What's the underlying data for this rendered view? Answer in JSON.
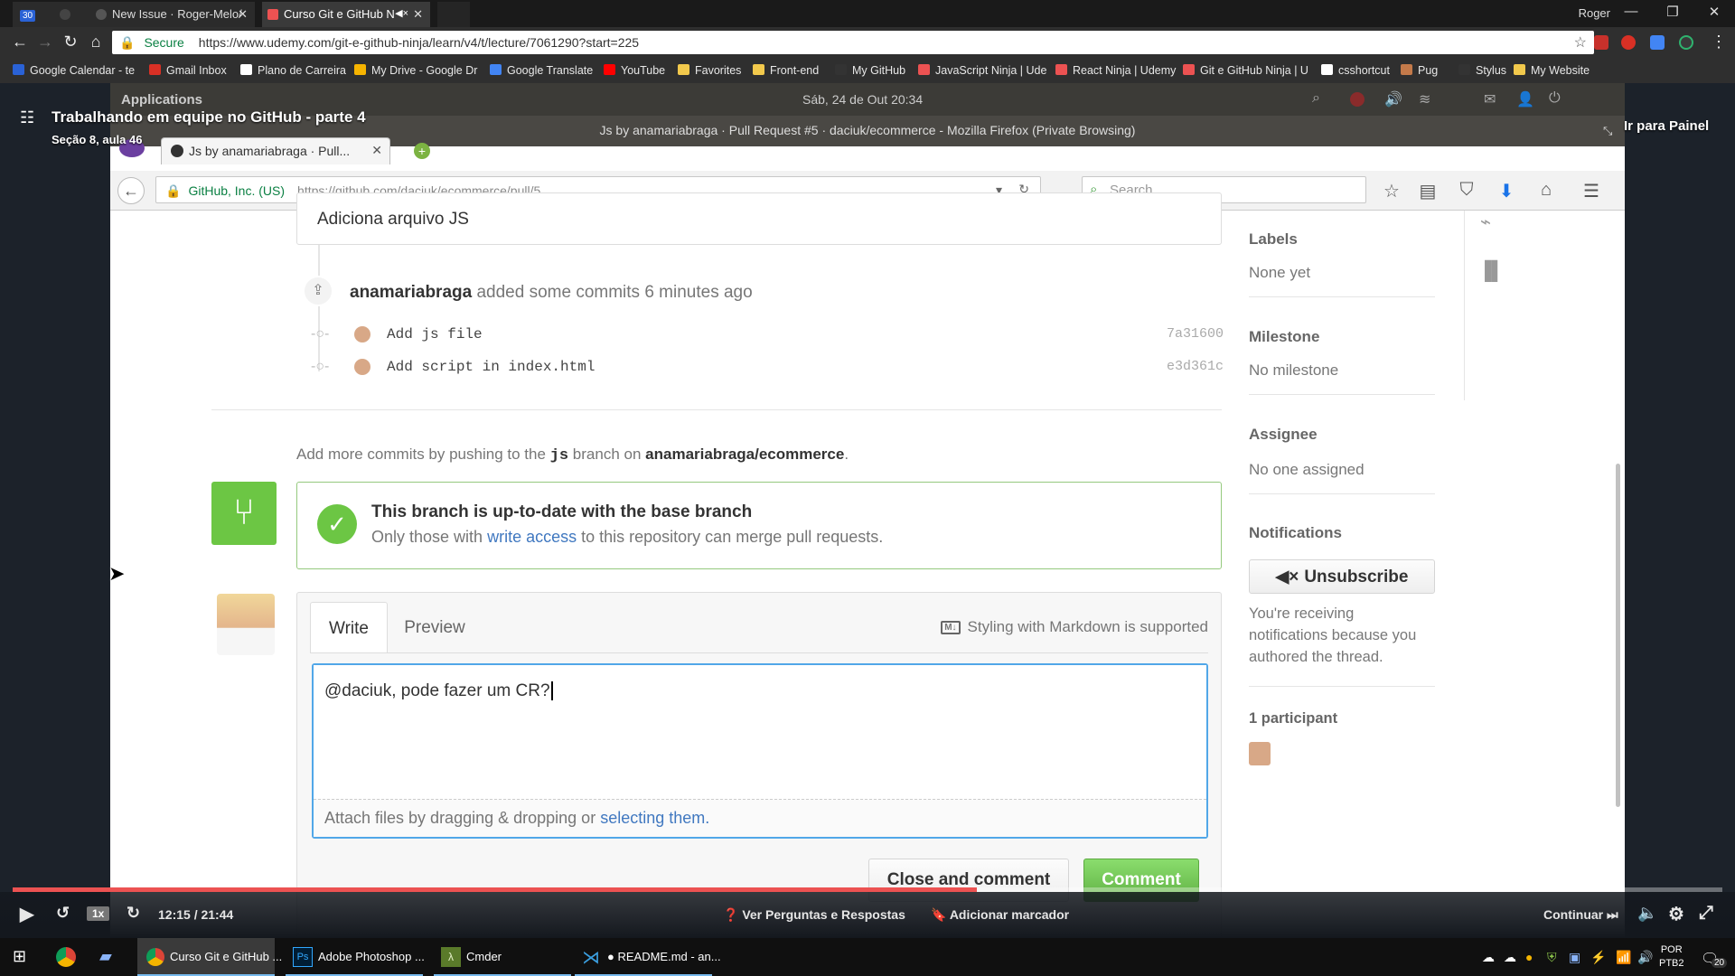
{
  "chrome": {
    "tabs": [
      {
        "label": "30"
      },
      {
        "label": ""
      },
      {
        "label": "New Issue · Roger-Melo/"
      },
      {
        "label": "Curso Git e GitHub N"
      }
    ],
    "user": "Roger",
    "secure_label": "Secure",
    "url": "https://www.udemy.com/git-e-github-ninja/learn/v4/t/lecture/7061290?start=225"
  },
  "bookmarks": [
    {
      "label": "Google Calendar - te",
      "color": "#2a62d6"
    },
    {
      "label": "Gmail Inbox",
      "color": "#d93025"
    },
    {
      "label": "Plano de Carreira",
      "color": "#ffffff"
    },
    {
      "label": "My Drive - Google Dr",
      "color": "#f6b400"
    },
    {
      "label": "Google Translate",
      "color": "#4285f4"
    },
    {
      "label": "YouTube",
      "color": "#ff0000"
    },
    {
      "label": "Favorites",
      "color": "#f2c94c"
    },
    {
      "label": "Front-end",
      "color": "#f2c94c"
    },
    {
      "label": "My GitHub",
      "color": "#333333"
    },
    {
      "label": "JavaScript Ninja | Ude",
      "color": "#ec5252"
    },
    {
      "label": "React Ninja | Udemy",
      "color": "#ec5252"
    },
    {
      "label": "Git e GitHub Ninja | U",
      "color": "#ec5252"
    },
    {
      "label": "csshortcut",
      "color": "#ffffff"
    },
    {
      "label": "Pug",
      "color": "#c47a4a"
    },
    {
      "label": "Stylus",
      "color": "#333333"
    },
    {
      "label": "My Website",
      "color": "#f2c94c"
    }
  ],
  "course": {
    "title": "Trabalhando em equipe no GitHub - parte 4",
    "subtitle": "Seção 8, aula 46",
    "goto_panel": "Ir para Painel"
  },
  "ubuntu": {
    "app_menu": "Applications",
    "clock": "Sáb, 24 de Out 20:34"
  },
  "firefox": {
    "window_title": "Js by anamariabraga · Pull Request #5 · daciuk/ecommerce - Mozilla Firefox (Private Browsing)",
    "tab_label": "Js by anamariabraga · Pull...",
    "identity": "GitHub, Inc. (US)",
    "url": "https://github.com/daciuk/ecommerce/pull/5",
    "search_placeholder": "Search"
  },
  "pr": {
    "first_comment_text": "Adiciona arquivo JS",
    "commits_author": "anamariabraga",
    "commits_event": "added some commits 6 minutes ago",
    "commits": [
      {
        "message": "Add js file",
        "sha": "7a31600"
      },
      {
        "message": "Add script in index.html",
        "sha": "e3d361c"
      }
    ],
    "push_hint_prefix": "Add more commits by pushing to the",
    "push_branch": "js",
    "push_hint_mid": "branch on",
    "push_repo": "anamariabraga/ecommerce",
    "merge_title": "This branch is up-to-date with the base branch",
    "merge_desc_prefix": "Only those with",
    "merge_desc_link": "write access",
    "merge_desc_suffix": "to this repository can merge pull requests.",
    "tab_write": "Write",
    "tab_preview": "Preview",
    "markdown_hint": "Styling with Markdown is supported",
    "comment_value": "@daciuk, pode fazer um CR?",
    "attach_prefix": "Attach files by dragging & dropping or",
    "attach_link": "selecting them.",
    "close_and_comment": "Close and comment",
    "comment_button": "Comment"
  },
  "sidebar": {
    "labels_h": "Labels",
    "labels_v": "None yet",
    "milestone_h": "Milestone",
    "milestone_v": "No milestone",
    "assignee_h": "Assignee",
    "assignee_v": "No one assigned",
    "notifications_h": "Notifications",
    "unsubscribe": "Unsubscribe",
    "notif_reason": "You're receiving notifications because you authored the thread.",
    "participants": "1 participant"
  },
  "player": {
    "speed": "1x",
    "time": "12:15 / 21:44",
    "progress": 0.564,
    "qa": "Ver Perguntas e Respostas",
    "bookmark": "Adicionar marcador",
    "continue": "Continuar"
  },
  "taskbar": {
    "items": [
      {
        "label": "Curso Git e GitHub ..."
      },
      {
        "label": "Adobe Photoshop ..."
      },
      {
        "label": "Cmder"
      },
      {
        "label": "● README.md - an..."
      }
    ],
    "lang": "POR",
    "layout": "PTB2",
    "notif_count": "20"
  }
}
